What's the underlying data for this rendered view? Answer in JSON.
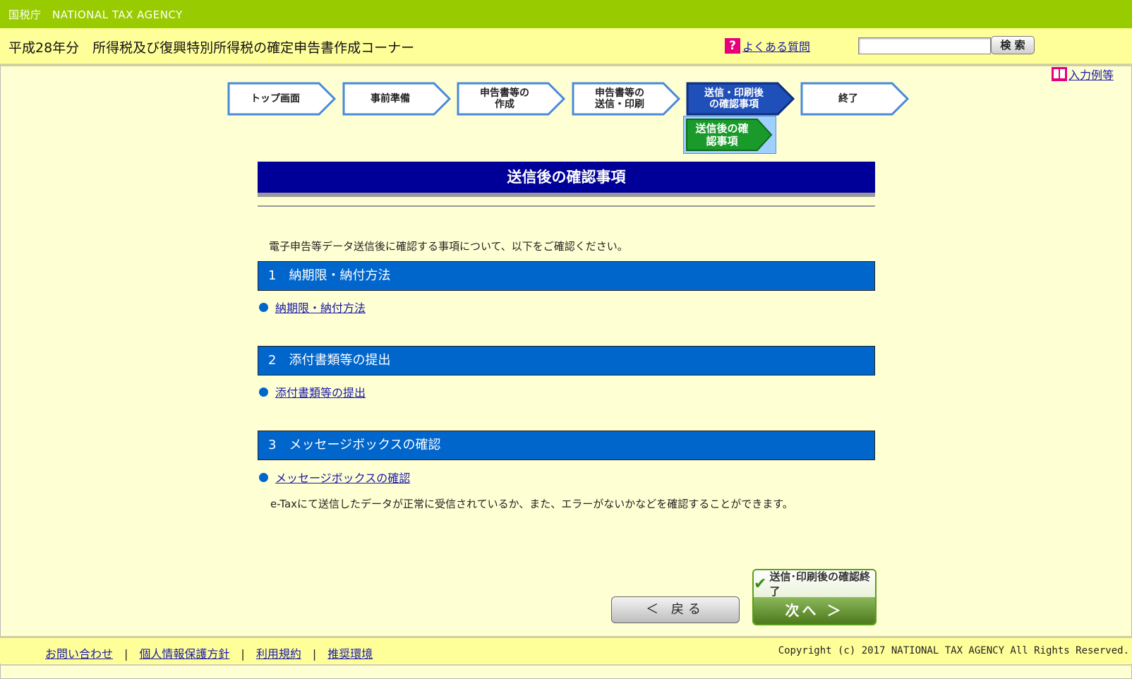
{
  "header": {
    "brand": "国税庁　NATIONAL TAX AGENCY",
    "title": "平成28年分　所得税及び復興特別所得税の確定申告書作成コーナー",
    "faq_label": "よくある質問",
    "search_button": "検 索",
    "search_value": "",
    "example_label": "入力例等"
  },
  "steps": [
    {
      "label": "トップ画面",
      "state": "normal"
    },
    {
      "label": "事前準備",
      "state": "normal"
    },
    {
      "label": "申告書等の\n作成",
      "state": "normal"
    },
    {
      "label": "申告書等の\n送信・印刷",
      "state": "normal"
    },
    {
      "label": "送信・印刷後\nの確認事項",
      "state": "active"
    },
    {
      "label": "終了",
      "state": "normal"
    }
  ],
  "substep": {
    "label": "送信後の確\n認事項"
  },
  "page": {
    "heading": "送信後の確認事項",
    "intro": "電子申告等データ送信後に確認する事項について、以下をご確認ください。",
    "sections": [
      {
        "title": "1　納期限・納付方法",
        "link": "納期限・納付方法"
      },
      {
        "title": "2　添付書類等の提出",
        "link": "添付書類等の提出"
      },
      {
        "title": "3　メッセージボックスの確認",
        "link": "メッセージボックスの確認"
      }
    ],
    "note": "e-Taxにて送信したデータが正常に受信されているか、また、エラーがないかなどを確認することができます。"
  },
  "buttons": {
    "back": "＜ 戻る",
    "finish_label": "送信･印刷後の確認終了",
    "next": "次へ ＞"
  },
  "footer": {
    "links": [
      "お問い合わせ",
      "個人情報保護方針",
      "利用規約",
      "推奨環境"
    ],
    "copyright": "Copyright (c) 2017 NATIONAL TAX AGENCY All Rights Reserved."
  },
  "colors": {
    "topbar": "#99cc00",
    "titlebar": "#ffff99",
    "background": "#ffffd4",
    "heading": "#000099",
    "section": "#0066cc",
    "active_step": "#1f4fb8",
    "substep": "#1a9a2a"
  }
}
